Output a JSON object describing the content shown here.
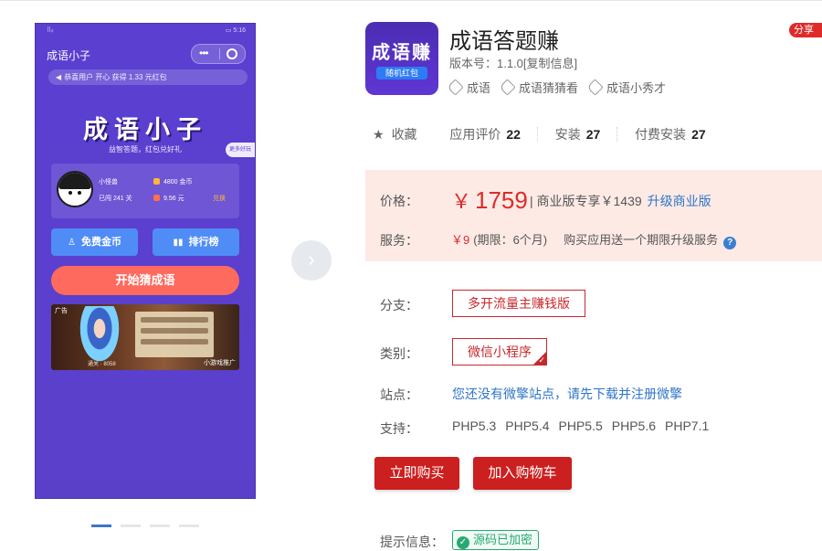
{
  "preview": {
    "status_left": "⠿ᵢₗ",
    "status_right": "▭ 5:16",
    "title": "成语小子",
    "notice": "恭喜用户 开心 获得 1.33 元红包",
    "logo_text": "成语小子",
    "subtitle": "益智答题，红包兑好礼",
    "more_games": "更多好玩",
    "user_name": "小怪兽",
    "level": "已闯 241 关",
    "coins": "4800 金币",
    "cash": "9.56 元",
    "withdraw": "兑换",
    "btn_free_coins": "免费金币",
    "btn_leaderboard": "排行榜",
    "btn_start": "开始猜成语",
    "banner_ad": "广告",
    "banner_mini": "小游戏推广",
    "banner_label": "通关 · 8058"
  },
  "carousel": {
    "pages": 4,
    "active": 0
  },
  "app": {
    "icon_text": "成语赚",
    "icon_badge": "随机红包",
    "title": "成语答题赚",
    "share_badge": "分享有",
    "version": "版本号：1.1.0[复制信息]",
    "tags": [
      "成语",
      "成语猜猜看",
      "成语小秀才"
    ]
  },
  "stats": {
    "favorite": "收藏",
    "rating_label": "应用评价",
    "rating": "22",
    "install_label": "安装",
    "install": "27",
    "paid_label": "付费安装",
    "paid": "27"
  },
  "price": {
    "label": "价格：",
    "yen": "￥",
    "amount": "1759",
    "extra": "| 商业版专享￥1439",
    "upgrade": "升级商业版",
    "service_label": "服务：",
    "service_price": "￥9",
    "service_term": "(期限：6个月)",
    "service_promo": "购买应用送一个期限升级服务"
  },
  "branch": {
    "label": "分支：",
    "value": "多开流量主赚钱版"
  },
  "category": {
    "label": "类别：",
    "value": "微信小程序"
  },
  "site": {
    "label": "站点：",
    "value": "您还没有微擎站点，请先下载并注册微擎"
  },
  "support": {
    "label": "支持：",
    "items": [
      "PHP5.3",
      "PHP5.4",
      "PHP5.5",
      "PHP5.6",
      "PHP7.1"
    ]
  },
  "actions": {
    "buy": "立即购买",
    "cart": "加入购物车"
  },
  "hint": {
    "label": "提示信息：",
    "value": "源码已加密"
  },
  "colors": {
    "brand_red": "#cc1f1f",
    "accent_blue": "#2e74c9",
    "phone_purple": "#5a3fd0"
  }
}
